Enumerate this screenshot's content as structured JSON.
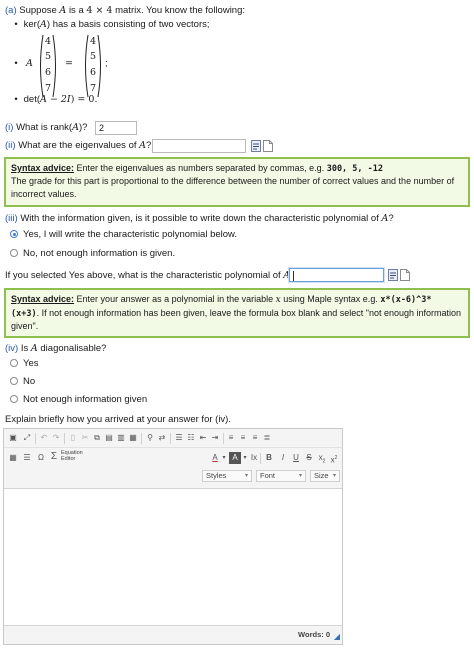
{
  "part_a": {
    "label": "(a)",
    "intro_pre": "Suppose",
    "matrix_var": "A",
    "intro_mid": "is a",
    "size_expr": "4 × 4",
    "intro_post": "matrix. You know the following:",
    "fact1_pre": "ker(",
    "fact1_var": "A",
    "fact1_post": ") has a basis consisting of two vectors;",
    "fact2_var": "A",
    "fact2_vector": [
      "4",
      "5",
      "6",
      "7"
    ],
    "fact2_eq": "=",
    "fact2_end": ";",
    "fact3_pre": "det(",
    "fact3_expr": "A − 2I",
    "fact3_post": ") = 0."
  },
  "q1": {
    "label": "(i)",
    "text": "What is rank(",
    "var": "A",
    "text_end": ")?",
    "value": "2"
  },
  "q2": {
    "label": "(ii)",
    "text": "What are the eigenvalues of",
    "var": "A",
    "text_end": "?",
    "value": ""
  },
  "advice1": {
    "title": "Syntax advice:",
    "line1_pre": "Enter the eigenvalues as numbers separated by commas, e.g.",
    "example": "300, 5, -12",
    "line2": "The grade for this part is proportional to the difference between the number of correct values and the number of",
    "line3": "incorrect values."
  },
  "q3": {
    "label": "(iii)",
    "text": "With the information given, is it possible to write down the characteristic polynomial of",
    "var": "A",
    "text_end": "?",
    "options": [
      "Yes, I will write the characteristic polynomial below.",
      "No, not enough information is given."
    ],
    "selected": 0,
    "followup": "If you selected Yes above, what is the characteristic polynomial of",
    "followup_var": "A",
    "followup_end": "?",
    "value": ""
  },
  "advice2": {
    "title": "Syntax advice:",
    "line1_pre": "Enter your answer as a polynomial in the variable",
    "var_x": "x",
    "line1_mid": "using Maple syntax e.g.",
    "example_a": "x*(x-6)^3*",
    "example_b": "(x+3)",
    "line2_rest": ". If not enough information has been given, leave the formula box blank and select \"not enough information",
    "line3": "given\"."
  },
  "q4": {
    "label": "(iv)",
    "text": "Is",
    "var": "A",
    "text_end": "diagonalisable?",
    "options": [
      "Yes",
      "No",
      "Not enough information given"
    ]
  },
  "explain_label": "Explain briefly how you arrived at your answer for (iv).",
  "editor": {
    "equation_line1": "Equation",
    "equation_line2": "Editor",
    "bold": "B",
    "italic": "I",
    "underline": "U",
    "strike": "S",
    "subscript": "x",
    "superscript": "x",
    "styles": "Styles",
    "font": "Font",
    "size": "Size",
    "words_label": "Words: 0"
  }
}
